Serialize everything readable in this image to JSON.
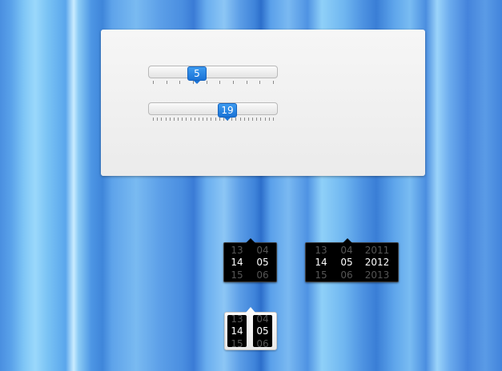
{
  "slider_a": {
    "value": "5",
    "fraction": 0.38
  },
  "slider_b": {
    "value": "19",
    "fraction": 0.62
  },
  "picker_day_month": {
    "day": {
      "prev": "13",
      "current": "14",
      "next": "15"
    },
    "month": {
      "prev": "04",
      "current": "05",
      "next": "06"
    }
  },
  "picker_date": {
    "day": {
      "prev": "13",
      "current": "14",
      "next": "15"
    },
    "month": {
      "prev": "04",
      "current": "05",
      "next": "06"
    },
    "year": {
      "prev": "2011",
      "current": "2012",
      "next": "2013"
    }
  },
  "picker_compact": {
    "day": {
      "prev": "13",
      "current": "14",
      "next": "15"
    },
    "month": {
      "prev": "04",
      "current": "05",
      "next": "06"
    }
  },
  "colors": {
    "accent": "#2a86e6",
    "picker_bg": "#000000"
  }
}
